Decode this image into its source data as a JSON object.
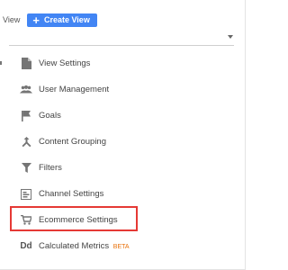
{
  "header": {
    "view_label": "View",
    "create_button_label": "Create View"
  },
  "menu": {
    "items": [
      {
        "label": "View Settings",
        "icon": "document-icon"
      },
      {
        "label": "User Management",
        "icon": "people-icon"
      },
      {
        "label": "Goals",
        "icon": "flag-icon"
      },
      {
        "label": "Content Grouping",
        "icon": "merge-icon"
      },
      {
        "label": "Filters",
        "icon": "funnel-icon"
      },
      {
        "label": "Channel Settings",
        "icon": "channel-icon"
      },
      {
        "label": "Ecommerce Settings",
        "icon": "cart-icon"
      },
      {
        "label": "Calculated Metrics",
        "badge": "BETA",
        "icon": "dd-icon",
        "icon_text": "Dd"
      }
    ]
  },
  "colors": {
    "accent": "#4285f4",
    "highlight": "#e53935",
    "beta": "#e8710a"
  }
}
